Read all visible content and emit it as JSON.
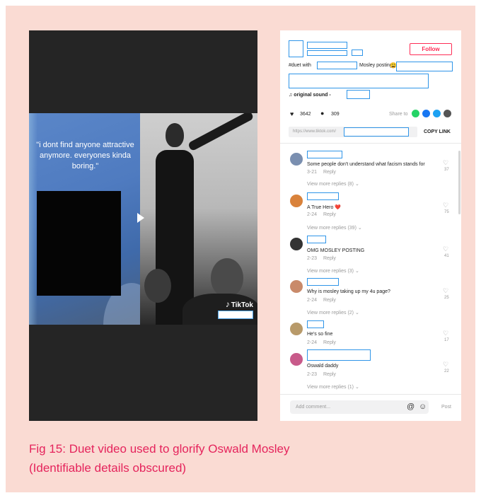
{
  "video": {
    "quote": "\"i dont find anyone attractive anymore. everyones kinda boring.\"",
    "watermark": "TikTok"
  },
  "post": {
    "follow_label": "Follow",
    "caption_prefix": "#duet with",
    "caption_mid": "Mosley posting",
    "caption_emoji": "😩",
    "sound_prefix": "♫ original sound -",
    "likes": "3642",
    "comments": "309",
    "share_label": "Share to",
    "link_text": "https://www.tiktok.com/",
    "copy_link_label": "COPY LINK"
  },
  "comments": [
    {
      "text": "Some people don't understand what facism stands for",
      "date": "3-21",
      "reply": "Reply",
      "likes": "37",
      "view_more": "View more replies (8)",
      "avatar_color": "#7a8fb0"
    },
    {
      "text": "A True Hero ❤️",
      "date": "2-24",
      "reply": "Reply",
      "likes": "75",
      "view_more": "View more replies (39)",
      "avatar_color": "#d9823b"
    },
    {
      "text": "OMG MOSLEY POSTING",
      "date": "2-23",
      "reply": "Reply",
      "likes": "41",
      "view_more": "View more replies (3)",
      "avatar_color": "#333333"
    },
    {
      "text": "Why is mosley taking up my 4u page?",
      "date": "2-24",
      "reply": "Reply",
      "likes": "25",
      "view_more": "View more replies (2)",
      "avatar_color": "#c98a6a"
    },
    {
      "text": "He's so fine",
      "date": "2-24",
      "reply": "Reply",
      "likes": "17",
      "view_more": "",
      "avatar_color": "#b89a6a"
    },
    {
      "text": "Oswald daddy",
      "date": "2-23",
      "reply": "Reply",
      "likes": "22",
      "view_more": "View more replies (1)",
      "avatar_color": "#c85a8a"
    }
  ],
  "composer": {
    "placeholder": "Add comment...",
    "post_label": "Post"
  },
  "figure_caption": {
    "line1": "Fig 15: Duet video used to glorify Oswald Mosley",
    "line2": "(Identifiable details obscured)"
  }
}
